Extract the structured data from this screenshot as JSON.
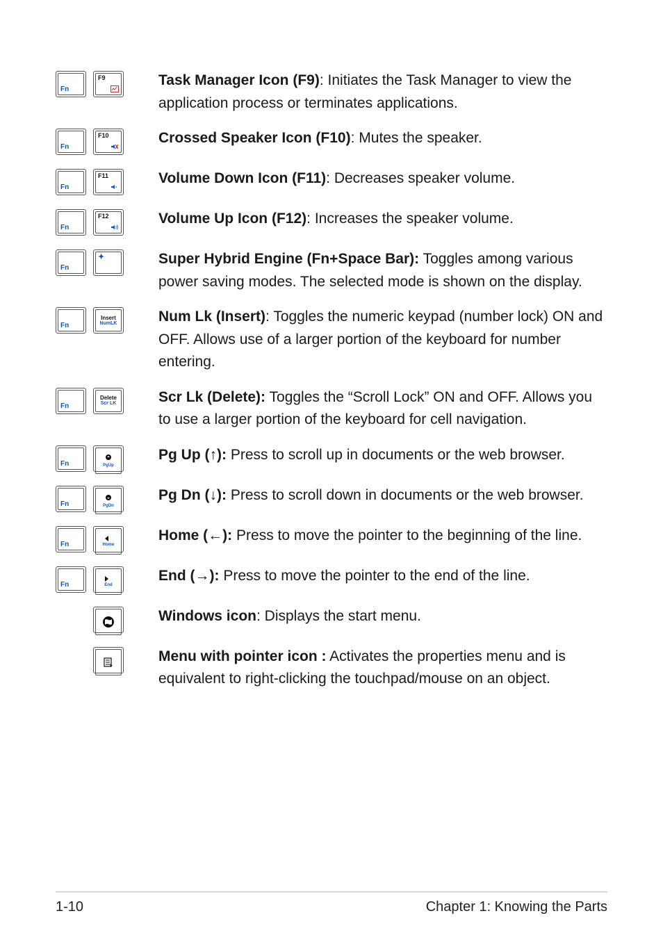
{
  "keys": {
    "fn": "Fn",
    "f9": "F9",
    "f10": "F10",
    "f11": "F11",
    "f12": "F12",
    "insert_top": "Insert",
    "insert_sub": "NumLK",
    "delete_top": "Delete",
    "delete_sub": "Scr LK",
    "pgup": "PgUp",
    "pgdn": "PgDn",
    "home": "Home",
    "end": "End"
  },
  "items": {
    "f9": {
      "title": "Task Manager Icon (F9)",
      "sep": ": ",
      "text": "Initiates the Task Manager to view the application process or terminates applications."
    },
    "f10": {
      "title": "Crossed Speaker Icon (F10)",
      "sep": ": ",
      "text": "Mutes the speaker."
    },
    "f11": {
      "title": "Volume Down Icon (F11)",
      "sep": ": ",
      "text": "Decreases speaker volume."
    },
    "f12": {
      "title": "Volume Up Icon (F12)",
      "sep": ": ",
      "text": "Increases the speaker volume."
    },
    "space": {
      "title": "Super Hybrid Engine (Fn+Space Bar):",
      "sep": " ",
      "text": "Toggles among various power saving modes. The selected mode is shown on the display."
    },
    "numlk": {
      "title": "Num Lk (Insert)",
      "sep": ": ",
      "text": "Toggles the numeric keypad (number lock) ON and OFF. Allows use of a larger portion of the keyboard for number entering."
    },
    "scrlk": {
      "title": "Scr Lk (Delete):",
      "sep": " ",
      "text": "Toggles the “Scroll Lock” ON and OFF. Allows you to use a larger portion of the keyboard for cell navigation."
    },
    "pgup": {
      "title": "Pg Up (↑):",
      "sep": " ",
      "text": "Press to scroll up in documents or the web browser."
    },
    "pgdn": {
      "title": "Pg Dn (↓):",
      "sep": " ",
      "text": "Press to scroll down in documents or the web browser."
    },
    "home": {
      "title": "Home (←):",
      "sep": " ",
      "text": "Press to move the pointer to the beginning of the line."
    },
    "end": {
      "title": "End (→):",
      "sep": " ",
      "text": "Press to move the pointer to the end of the line."
    },
    "win": {
      "title": "Windows icon",
      "sep": ": ",
      "text": "Displays the start menu."
    },
    "menu": {
      "title": "Menu with pointer icon :",
      "sep": " ",
      "text": "Activates the properties menu and is equivalent to right-clicking the touchpad/mouse on an object."
    }
  },
  "footer": {
    "left": "1-10",
    "right": "Chapter 1: Knowing the Parts"
  }
}
